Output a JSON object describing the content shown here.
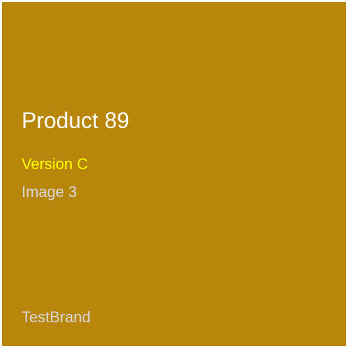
{
  "product": {
    "title": "Product 89",
    "version": "Version C",
    "image_label": "Image 3",
    "brand": "TestBrand"
  },
  "colors": {
    "background": "#B8860B",
    "title": "#FFFFFF",
    "version": "#FFFF00",
    "secondary_text": "#D8D8D8",
    "border": "#FFFFFF"
  }
}
